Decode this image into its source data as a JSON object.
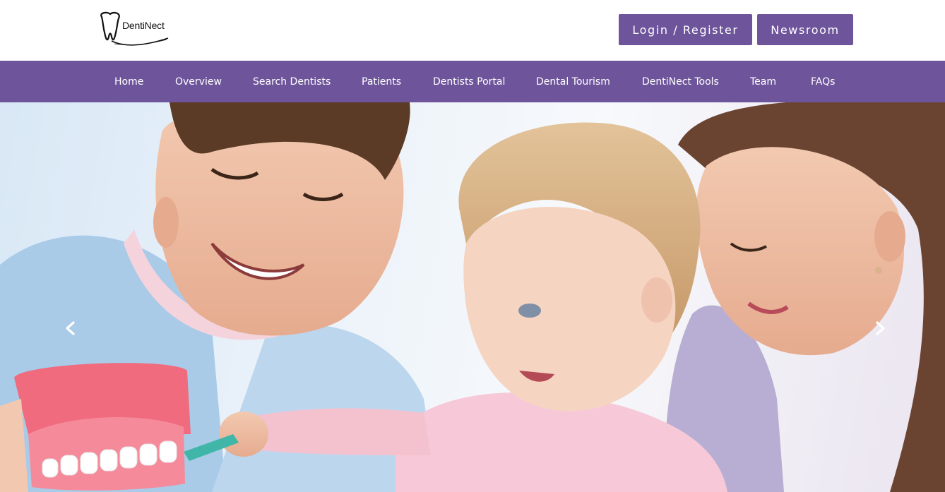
{
  "brand": {
    "logo_text": "DentiNect",
    "accent_color": "#6e559b"
  },
  "header": {
    "login_label": "Login / Register",
    "newsroom_label": "Newsroom"
  },
  "nav": {
    "items": [
      {
        "label": "Home"
      },
      {
        "label": "Overview"
      },
      {
        "label": "Search Dentists"
      },
      {
        "label": "Patients"
      },
      {
        "label": "Dentists Portal"
      },
      {
        "label": "Dental Tourism"
      },
      {
        "label": "DentiNect Tools"
      },
      {
        "label": "Team"
      },
      {
        "label": "FAQs"
      }
    ]
  },
  "hero": {
    "prev_icon": "chevron-left-icon",
    "next_icon": "chevron-right-icon"
  }
}
